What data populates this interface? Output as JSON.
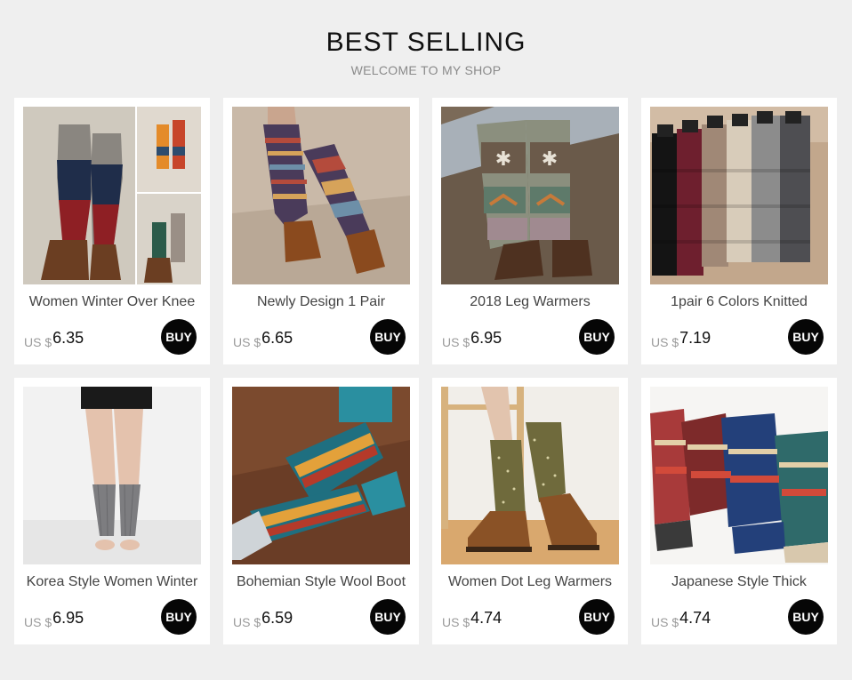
{
  "header": {
    "title": "BEST SELLING",
    "subtitle": "WELCOME TO MY SHOP"
  },
  "currency": "US $",
  "buy_label": "BUY",
  "products": [
    {
      "name": "Women Winter Over Knee",
      "price": "6.35"
    },
    {
      "name": "Newly Design 1 Pair",
      "price": "6.65"
    },
    {
      "name": "2018 Leg Warmers",
      "price": "6.95"
    },
    {
      "name": "1pair 6 Colors Knitted",
      "price": "7.19"
    },
    {
      "name": "Korea Style Women Winter",
      "price": "6.95"
    },
    {
      "name": "Bohemian Style Wool Boot",
      "price": "6.59"
    },
    {
      "name": "Women Dot Leg Warmers",
      "price": "4.74"
    },
    {
      "name": "Japanese Style Thick",
      "price": "4.74"
    }
  ]
}
